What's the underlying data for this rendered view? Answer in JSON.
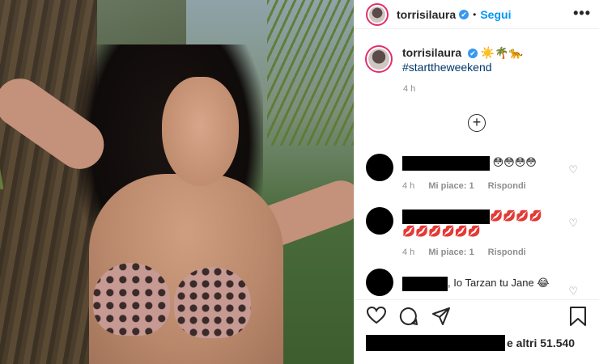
{
  "post": {
    "username": "torrisilaura",
    "follow_label": "Segui",
    "caption_emojis": "☀️🌴🐆",
    "hashtag": "#starttheweekend",
    "time": "4 h",
    "more_label": "•••",
    "dot": "•",
    "add_label": "+",
    "verified_mark": "✔"
  },
  "comments": [
    {
      "text": "😳😳😳😳",
      "time": "4 h",
      "likes": "Mi piace: 1",
      "reply": "Rispondi"
    },
    {
      "text": "💋💋💋💋💋💋💋💋💋💋",
      "time": "4 h",
      "likes": "Mi piace: 1",
      "reply": "Rispondi"
    },
    {
      "text": ", Io Tarzan tu Jane 😂"
    }
  ],
  "likes": {
    "suffix": "e altri 51.540"
  },
  "icons": [
    "heart-icon",
    "comment-icon",
    "share-icon",
    "save-icon",
    "more-icon",
    "add-comment-icon"
  ]
}
